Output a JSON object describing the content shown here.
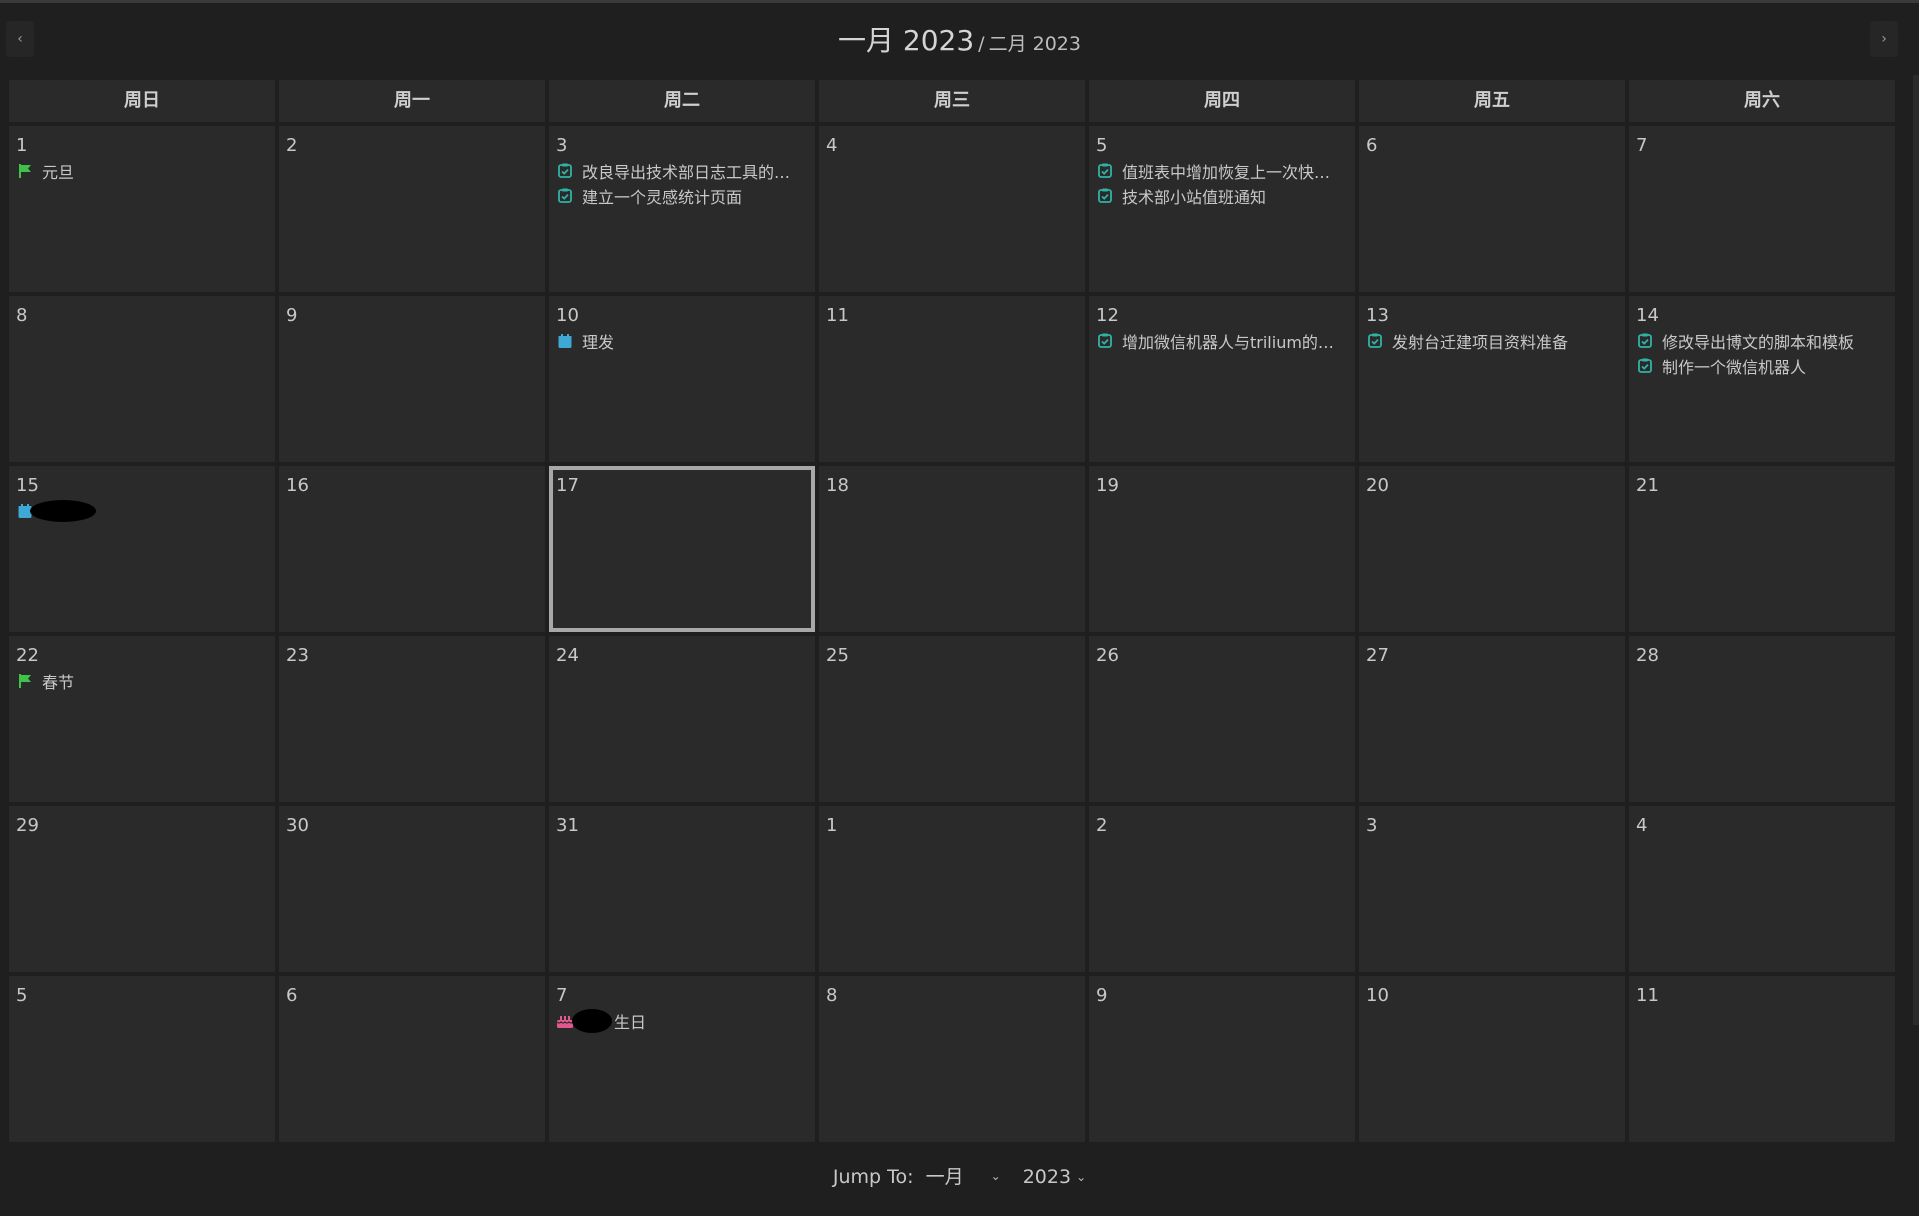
{
  "header": {
    "title_main": "一月 2023",
    "title_separator": "/",
    "title_sub": "二月 2023",
    "prev_label": "‹",
    "next_label": "›"
  },
  "weekdays": [
    "周日",
    "周一",
    "周二",
    "周三",
    "周四",
    "周五",
    "周六"
  ],
  "today_index": 16,
  "colors": {
    "task": "#2fb3a5",
    "holiday": "#3fc24a",
    "calendar": "#3fa9d6",
    "birthday": "#e0588e"
  },
  "days": [
    {
      "day": "1",
      "events": [
        {
          "type": "holiday",
          "icon": "flag-icon",
          "label": "元旦"
        }
      ]
    },
    {
      "day": "2",
      "events": []
    },
    {
      "day": "3",
      "events": [
        {
          "type": "task",
          "icon": "checkbox-icon",
          "label": "改良导出技术部日志工具的…"
        },
        {
          "type": "task",
          "icon": "checkbox-icon",
          "label": "建立一个灵感统计页面"
        }
      ]
    },
    {
      "day": "4",
      "events": []
    },
    {
      "day": "5",
      "events": [
        {
          "type": "task",
          "icon": "checkbox-icon",
          "label": "值班表中增加恢复上一次快…"
        },
        {
          "type": "task",
          "icon": "checkbox-icon",
          "label": "技术部小站值班通知"
        }
      ]
    },
    {
      "day": "6",
      "events": []
    },
    {
      "day": "7",
      "events": []
    },
    {
      "day": "8",
      "events": []
    },
    {
      "day": "9",
      "events": []
    },
    {
      "day": "10",
      "events": [
        {
          "type": "calendar",
          "icon": "calendar-icon",
          "label": "理发"
        }
      ]
    },
    {
      "day": "11",
      "events": []
    },
    {
      "day": "12",
      "events": [
        {
          "type": "task",
          "icon": "checkbox-icon",
          "label": "增加微信机器人与trilium的…"
        }
      ]
    },
    {
      "day": "13",
      "events": [
        {
          "type": "task",
          "icon": "checkbox-icon",
          "label": "发射台迁建项目资料准备"
        }
      ]
    },
    {
      "day": "14",
      "events": [
        {
          "type": "task",
          "icon": "checkbox-icon",
          "label": "修改导出博文的脚本和模板"
        },
        {
          "type": "task",
          "icon": "checkbox-icon",
          "label": "制作一个微信机器人"
        }
      ]
    },
    {
      "day": "15",
      "events": [
        {
          "type": "calendar",
          "icon": "calendar-icon",
          "label": "",
          "redacted": "wide"
        }
      ]
    },
    {
      "day": "16",
      "events": []
    },
    {
      "day": "17",
      "events": []
    },
    {
      "day": "18",
      "events": []
    },
    {
      "day": "19",
      "events": []
    },
    {
      "day": "20",
      "events": []
    },
    {
      "day": "21",
      "events": []
    },
    {
      "day": "22",
      "events": [
        {
          "type": "holiday",
          "icon": "flag-icon",
          "label": "春节"
        }
      ]
    },
    {
      "day": "23",
      "events": []
    },
    {
      "day": "24",
      "events": []
    },
    {
      "day": "25",
      "events": []
    },
    {
      "day": "26",
      "events": []
    },
    {
      "day": "27",
      "events": []
    },
    {
      "day": "28",
      "events": []
    },
    {
      "day": "29",
      "events": []
    },
    {
      "day": "30",
      "events": []
    },
    {
      "day": "31",
      "events": []
    },
    {
      "day": "1",
      "events": []
    },
    {
      "day": "2",
      "events": []
    },
    {
      "day": "3",
      "events": []
    },
    {
      "day": "4",
      "events": []
    },
    {
      "day": "5",
      "events": []
    },
    {
      "day": "6",
      "events": []
    },
    {
      "day": "7",
      "events": [
        {
          "type": "birthday",
          "icon": "birthday-cake-icon",
          "label": "生日",
          "redacted": "small"
        }
      ]
    },
    {
      "day": "8",
      "events": []
    },
    {
      "day": "9",
      "events": []
    },
    {
      "day": "10",
      "events": []
    },
    {
      "day": "11",
      "events": []
    }
  ],
  "footer": {
    "jump_to_label": "Jump To:",
    "month_value": "一月",
    "year_value": "2023"
  }
}
